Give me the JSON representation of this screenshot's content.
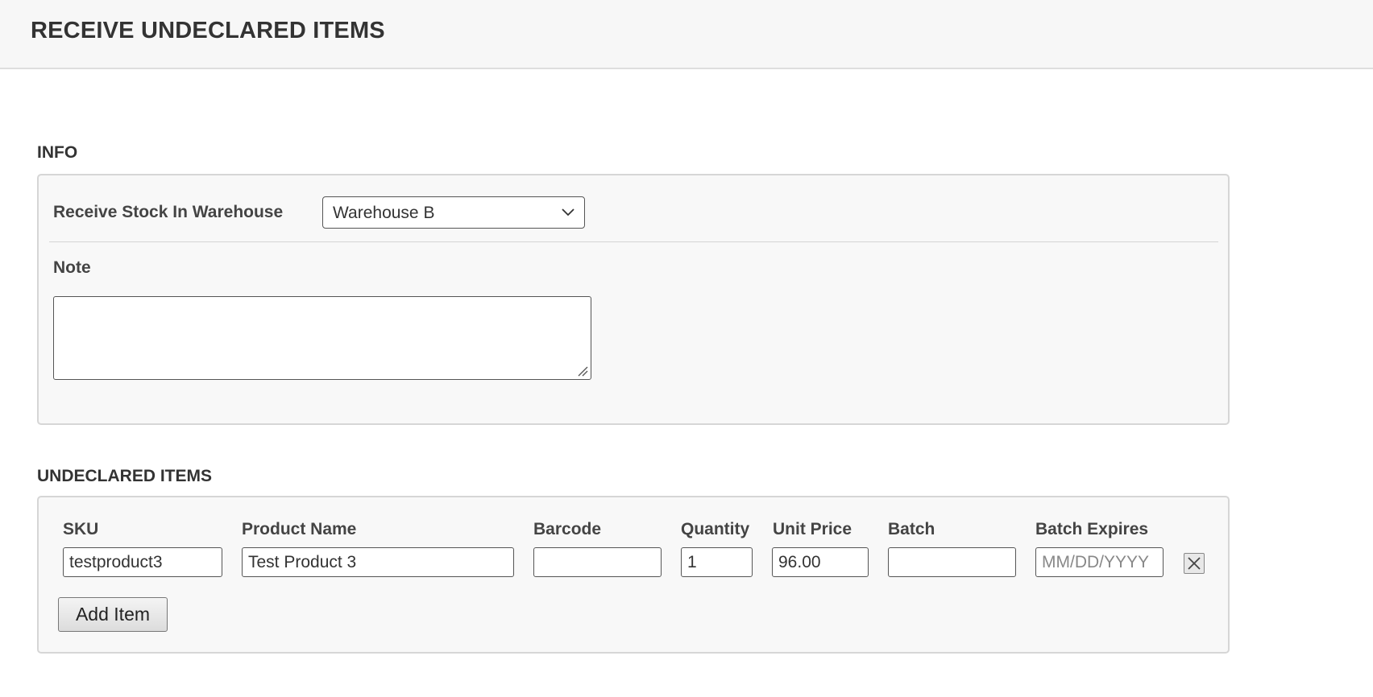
{
  "header": {
    "title": "RECEIVE UNDECLARED ITEMS"
  },
  "info": {
    "section_title": "INFO",
    "warehouse_label": "Receive Stock In Warehouse",
    "warehouse_selected": "Warehouse B",
    "note_label": "Note",
    "note_value": ""
  },
  "items": {
    "section_title": "UNDECLARED ITEMS",
    "columns": {
      "sku": "SKU",
      "product_name": "Product Name",
      "barcode": "Barcode",
      "quantity": "Quantity",
      "unit_price": "Unit Price",
      "batch": "Batch",
      "batch_expires": "Batch Expires"
    },
    "rows": [
      {
        "sku": "testproduct3",
        "product_name": "Test Product 3",
        "barcode": "",
        "quantity": "1",
        "unit_price": "96.00",
        "batch": "",
        "batch_expires": "",
        "batch_expires_placeholder": "MM/DD/YYYY"
      }
    ],
    "add_item_label": "Add Item"
  },
  "icons": {
    "select_chevron": "chevron-down-icon",
    "remove_row": "close-icon",
    "textarea_resize": "resize-grip-icon"
  }
}
